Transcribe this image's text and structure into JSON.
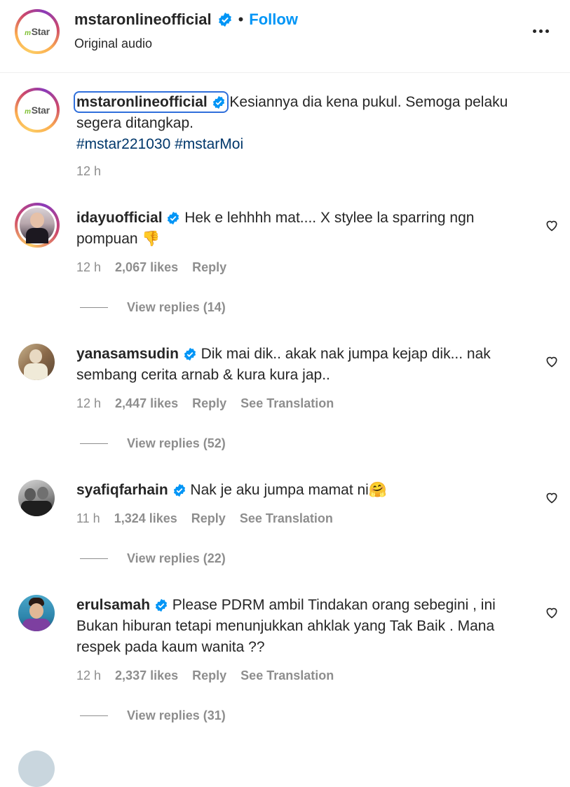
{
  "header": {
    "username": "mstaronlineofficial",
    "separator": "•",
    "follow_label": "Follow",
    "subtitle": "Original audio",
    "logo_text": "Star",
    "logo_prefix": "m"
  },
  "caption": {
    "username": "mstaronlineofficial",
    "text": " Kesiannya dia kena pukul. Semoga pelaku segera ditangkap.",
    "hashtags": "#mstar221030 #mstarMoi",
    "time": "12 h"
  },
  "comments": [
    {
      "username": "idayuofficial",
      "text": " Hek e lehhhh mat.... X stylee la sparring ngn pompuan 👎",
      "time": "12 h",
      "likes": "2,067 likes",
      "reply": "Reply",
      "translate": "",
      "view_replies": "View replies (14)"
    },
    {
      "username": "yanasamsudin",
      "text": " Dik mai dik.. akak nak jumpa kejap dik... nak sembang cerita arnab & kura kura jap..",
      "time": "12 h",
      "likes": "2,447 likes",
      "reply": "Reply",
      "translate": "See Translation",
      "view_replies": "View replies (52)"
    },
    {
      "username": "syafiqfarhain",
      "text": " Nak je aku jumpa mamat ni🤗",
      "time": "11 h",
      "likes": "1,324 likes",
      "reply": "Reply",
      "translate": "See Translation",
      "view_replies": "View replies (22)"
    },
    {
      "username": "erulsamah",
      "text": " Please PDRM ambil Tindakan orang sebegini , ini Bukan hiburan tetapi menunjukkan ahklak yang Tak Baik . Mana respek pada kaum wanita ??",
      "time": "12 h",
      "likes": "2,337 likes",
      "reply": "Reply",
      "translate": "See Translation",
      "view_replies": "View replies (31)"
    }
  ],
  "colors": {
    "link": "#0095f6",
    "hashtag": "#00376b",
    "muted": "#8e8e8e",
    "verified": "#0095f6"
  }
}
